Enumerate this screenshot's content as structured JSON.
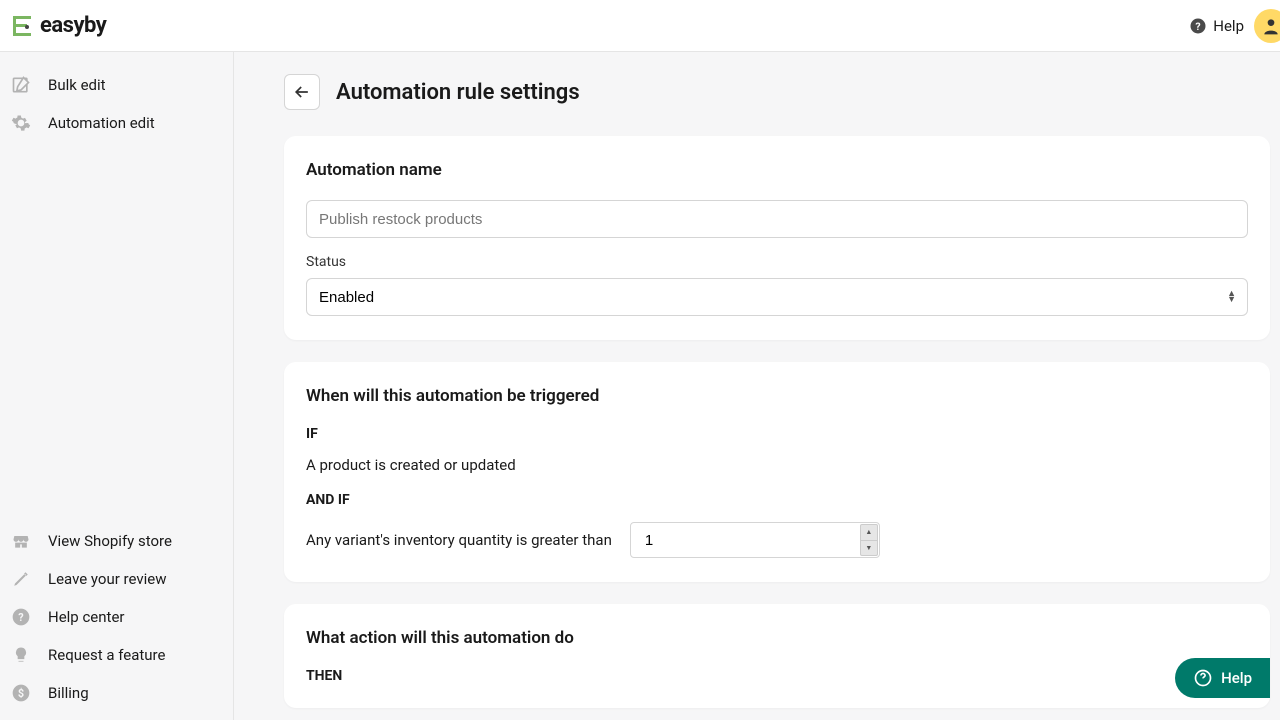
{
  "brand": {
    "name": "easyby"
  },
  "topbar": {
    "help_label": "Help"
  },
  "sidebar": {
    "top": [
      {
        "label": "Bulk edit"
      },
      {
        "label": "Automation edit"
      }
    ],
    "bottom": [
      {
        "label": "View Shopify store"
      },
      {
        "label": "Leave your review"
      },
      {
        "label": "Help center"
      },
      {
        "label": "Request a feature"
      },
      {
        "label": "Billing"
      }
    ]
  },
  "page": {
    "title": "Automation rule settings"
  },
  "card1": {
    "title": "Automation name",
    "name_placeholder": "Publish restock products",
    "status_label": "Status",
    "status_value": "Enabled"
  },
  "card2": {
    "title": "When will this automation be triggered",
    "if_label": "IF",
    "if_text": "A product is created or updated",
    "andif_label": "AND IF",
    "andif_text": "Any variant's inventory quantity is greater than",
    "qty_value": "1"
  },
  "card3": {
    "title": "What action will this automation do",
    "then_label": "THEN"
  },
  "fab": {
    "label": "Help"
  }
}
